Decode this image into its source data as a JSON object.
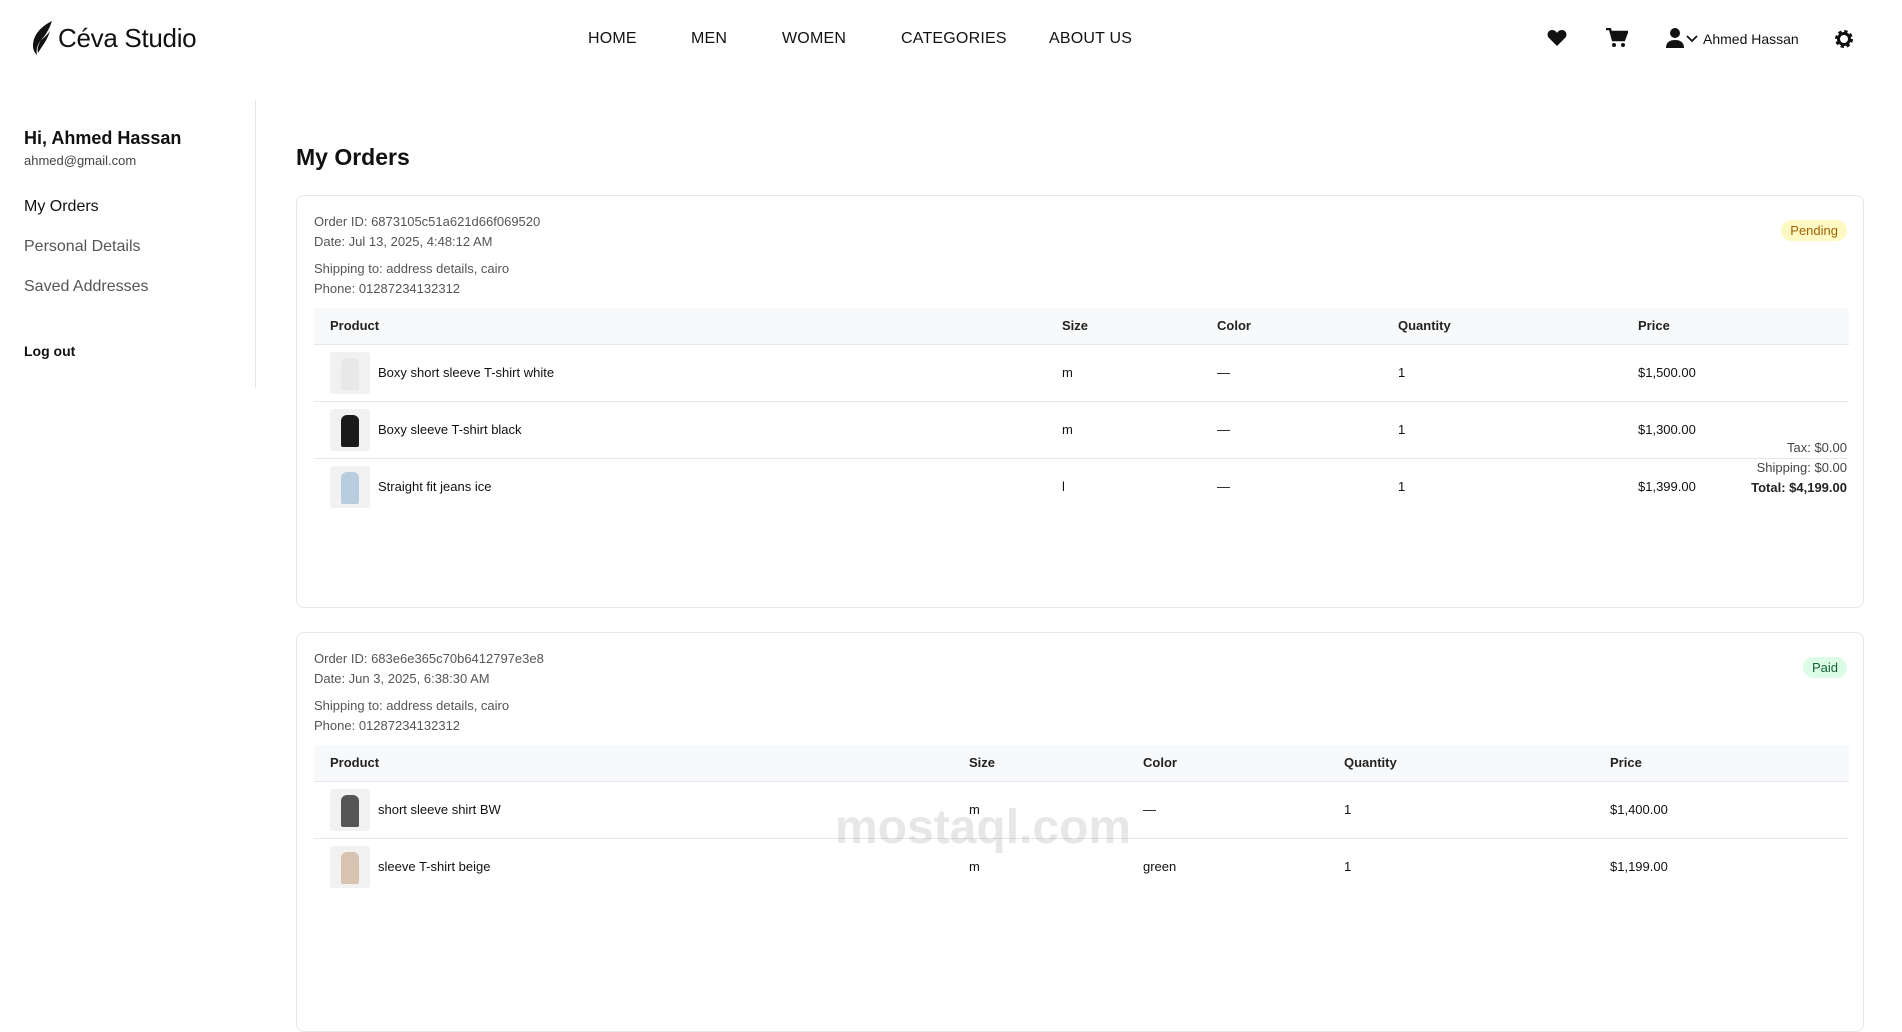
{
  "brand": {
    "name": "Céva Studio"
  },
  "nav": [
    "HOME",
    "MEN",
    "WOMEN",
    "CATEGORIES",
    "ABOUT US"
  ],
  "header": {
    "user_name": "Ahmed Hassan",
    "icons": [
      "heart-icon",
      "cart-icon",
      "user-icon",
      "chevron-down-icon",
      "gear-icon"
    ]
  },
  "sidebar": {
    "greeting": "Hi, Ahmed Hassan",
    "email": "ahmed@gmail.com",
    "items": [
      "My Orders",
      "Personal Details",
      "Saved Addresses"
    ],
    "logout": "Log out"
  },
  "page_title": "My Orders",
  "columns": [
    "Product",
    "Size",
    "Color",
    "Quantity",
    "Price"
  ],
  "orders": [
    {
      "id": "Order ID: 6873105c51a621d66f069520",
      "date": "Date: Jul 13, 2025, 4:48:12 AM",
      "shipping": "Shipping to: address details, cairo",
      "phone": "Phone: 01287234132312",
      "status": "Pending",
      "items": [
        {
          "name": "Boxy short sleeve T-shirt white",
          "size": "m",
          "color": "—",
          "qty": "1",
          "price": "$1,500.00",
          "swatch": "#e8e8e8"
        },
        {
          "name": "Boxy sleeve T-shirt black",
          "size": "m",
          "color": "—",
          "qty": "1",
          "price": "$1,300.00",
          "swatch": "#1a1a1a"
        },
        {
          "name": "Straight fit jeans ice",
          "size": "l",
          "color": "—",
          "qty": "1",
          "price": "$1,399.00",
          "swatch": "#b8cde0"
        }
      ],
      "tax": "Tax: $0.00",
      "shipping_cost": "Shipping: $0.00",
      "total": "Total: $4,199.00"
    },
    {
      "id": "Order ID: 683e6e365c70b6412797e3e8",
      "date": "Date: Jun 3, 2025, 6:38:30 AM",
      "shipping": "Shipping to: address details, cairo",
      "phone": "Phone: 01287234132312",
      "status": "Paid",
      "items": [
        {
          "name": "short sleeve shirt BW",
          "size": "m",
          "color": "—",
          "qty": "1",
          "price": "$1,400.00",
          "swatch": "#555"
        },
        {
          "name": "sleeve T-shirt beige",
          "size": "m",
          "color": "green",
          "qty": "1",
          "price": "$1,199.00",
          "swatch": "#d8c2b0"
        }
      ]
    }
  ],
  "watermark": "mostaql.com"
}
